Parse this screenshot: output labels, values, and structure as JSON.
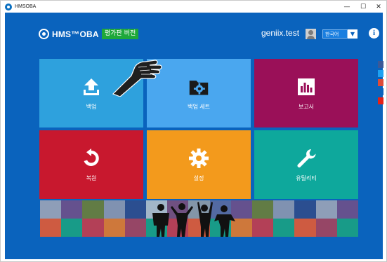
{
  "window": {
    "title": "HMSOBA",
    "controls": {
      "minimize": "—",
      "maximize": "☐",
      "close": "✕"
    }
  },
  "header": {
    "brand": "HMS™OBA",
    "trial_badge": "평가판 버전",
    "username": "geniix.test",
    "language": "한국어",
    "info_label": "i"
  },
  "tiles": [
    {
      "id": "backup",
      "label": "백업",
      "icon": "upload-icon",
      "color": "#2ea1dd"
    },
    {
      "id": "backup-set",
      "label": "백업 세트",
      "icon": "folder-gear-icon",
      "color": "#4aa7ef"
    },
    {
      "id": "report",
      "label": "보고서",
      "icon": "bar-chart-icon",
      "color": "#9a1058"
    },
    {
      "id": "restore",
      "label": "복원",
      "icon": "restore-arrow-icon",
      "color": "#c8182e"
    },
    {
      "id": "settings",
      "label": "설정",
      "icon": "gear-icon",
      "color": "#f39a1c"
    },
    {
      "id": "utility",
      "label": "유틸리티",
      "icon": "wrench-icon",
      "color": "#0ea89c"
    }
  ],
  "social_icons": [
    "facebook-icon",
    "twitter-icon",
    "google-plus-icon",
    "linkedin-icon",
    "youtube-icon"
  ],
  "colors": {
    "background": "#0a63bd",
    "trial_badge": "#1ea83a",
    "banner_palette": [
      "#9aa3b7",
      "#6e4f8a",
      "#6a7e3b",
      "#8b96b0",
      "#2f4c8c",
      "#b0bdc9",
      "#7a4e7c",
      "#8e9aa6",
      "#5a6aa0",
      "#6e4f8a",
      "#6a7e3b",
      "#8b96b0",
      "#2f4c8c",
      "#9aa3b7",
      "#6e4f8a",
      "#e05a36",
      "#1aa083",
      "#c23d4e",
      "#e07a30",
      "#a3435e",
      "#1aa083",
      "#c23d4e",
      "#e05a36",
      "#1aa083",
      "#e07a30",
      "#c23d4e",
      "#1aa083",
      "#e05a36",
      "#a3435e",
      "#1aa083"
    ]
  }
}
